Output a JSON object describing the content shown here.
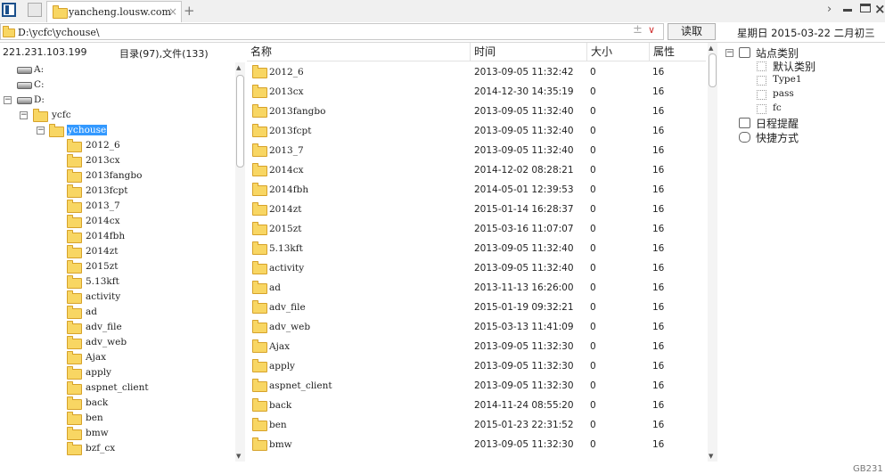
{
  "tabbar": {
    "tab_title": "yancheng.lousw.com",
    "tab_close": "×",
    "new_tab": "+"
  },
  "address": {
    "path": "D:\\ycfc\\ychouse\\",
    "plus_glyph": "±",
    "dropdown_glyph": "∨",
    "read_button": "读取"
  },
  "date": {
    "weekday": "星期日",
    "date": "2015-03-22",
    "lunar": "二月初三"
  },
  "info": {
    "ip": "221.231.103.199",
    "counts": "目录(97),文件(133)"
  },
  "tree": {
    "drives": [
      "A:",
      "C:",
      "D:"
    ],
    "parent": "ycfc",
    "selected": "ychouse",
    "children": [
      "2012_6",
      "2013cx",
      "2013fangbo",
      "2013fcpt",
      "2013_7",
      "2014cx",
      "2014fbh",
      "2014zt",
      "2015zt",
      "5.13kft",
      "activity",
      "ad",
      "adv_file",
      "adv_web",
      "Ajax",
      "apply",
      "aspnet_client",
      "back",
      "ben",
      "bmw",
      "bzf_cx"
    ]
  },
  "list": {
    "columns": {
      "name": "名称",
      "time": "时间",
      "size": "大小",
      "attr": "属性"
    },
    "rows": [
      {
        "name": "2012_6",
        "time": "2013-09-05 11:32:42",
        "size": "0",
        "attr": "16"
      },
      {
        "name": "2013cx",
        "time": "2014-12-30 14:35:19",
        "size": "0",
        "attr": "16"
      },
      {
        "name": "2013fangbo",
        "time": "2013-09-05 11:32:40",
        "size": "0",
        "attr": "16"
      },
      {
        "name": "2013fcpt",
        "time": "2013-09-05 11:32:40",
        "size": "0",
        "attr": "16"
      },
      {
        "name": "2013_7",
        "time": "2013-09-05 11:32:40",
        "size": "0",
        "attr": "16"
      },
      {
        "name": "2014cx",
        "time": "2014-12-02 08:28:21",
        "size": "0",
        "attr": "16"
      },
      {
        "name": "2014fbh",
        "time": "2014-05-01 12:39:53",
        "size": "0",
        "attr": "16"
      },
      {
        "name": "2014zt",
        "time": "2015-01-14 16:28:37",
        "size": "0",
        "attr": "16"
      },
      {
        "name": "2015zt",
        "time": "2015-03-16 11:07:07",
        "size": "0",
        "attr": "16"
      },
      {
        "name": "5.13kft",
        "time": "2013-09-05 11:32:40",
        "size": "0",
        "attr": "16"
      },
      {
        "name": "activity",
        "time": "2013-09-05 11:32:40",
        "size": "0",
        "attr": "16"
      },
      {
        "name": "ad",
        "time": "2013-11-13 16:26:00",
        "size": "0",
        "attr": "16"
      },
      {
        "name": "adv_file",
        "time": "2015-01-19 09:32:21",
        "size": "0",
        "attr": "16"
      },
      {
        "name": "adv_web",
        "time": "2015-03-13 11:41:09",
        "size": "0",
        "attr": "16"
      },
      {
        "name": "Ajax",
        "time": "2013-09-05 11:32:30",
        "size": "0",
        "attr": "16"
      },
      {
        "name": "apply",
        "time": "2013-09-05 11:32:30",
        "size": "0",
        "attr": "16"
      },
      {
        "name": "aspnet_client",
        "time": "2013-09-05 11:32:30",
        "size": "0",
        "attr": "16"
      },
      {
        "name": "back",
        "time": "2014-11-24 08:55:20",
        "size": "0",
        "attr": "16"
      },
      {
        "name": "ben",
        "time": "2015-01-23 22:31:52",
        "size": "0",
        "attr": "16"
      },
      {
        "name": "bmw",
        "time": "2013-09-05 11:32:30",
        "size": "0",
        "attr": "16"
      }
    ]
  },
  "right_panel": {
    "site_category": "站点类别",
    "categories": [
      "默认类别",
      "Type1",
      "pass",
      "fc"
    ],
    "schedule": "日程提醒",
    "shortcuts": "快捷方式"
  },
  "footer": {
    "corner_text": "GB231"
  },
  "icons": {
    "panel_toggle": "panel-toggle-icon",
    "blank_tab": "blank-tab-icon",
    "folder": "folder-icon",
    "drive": "drive-icon",
    "minimize": "minimize-icon",
    "maximize": "maximize-icon",
    "close": "close-icon"
  },
  "colors": {
    "selection": "#3399ff",
    "folder": "#f8d663",
    "dropdown_arrow": "#d03030"
  }
}
